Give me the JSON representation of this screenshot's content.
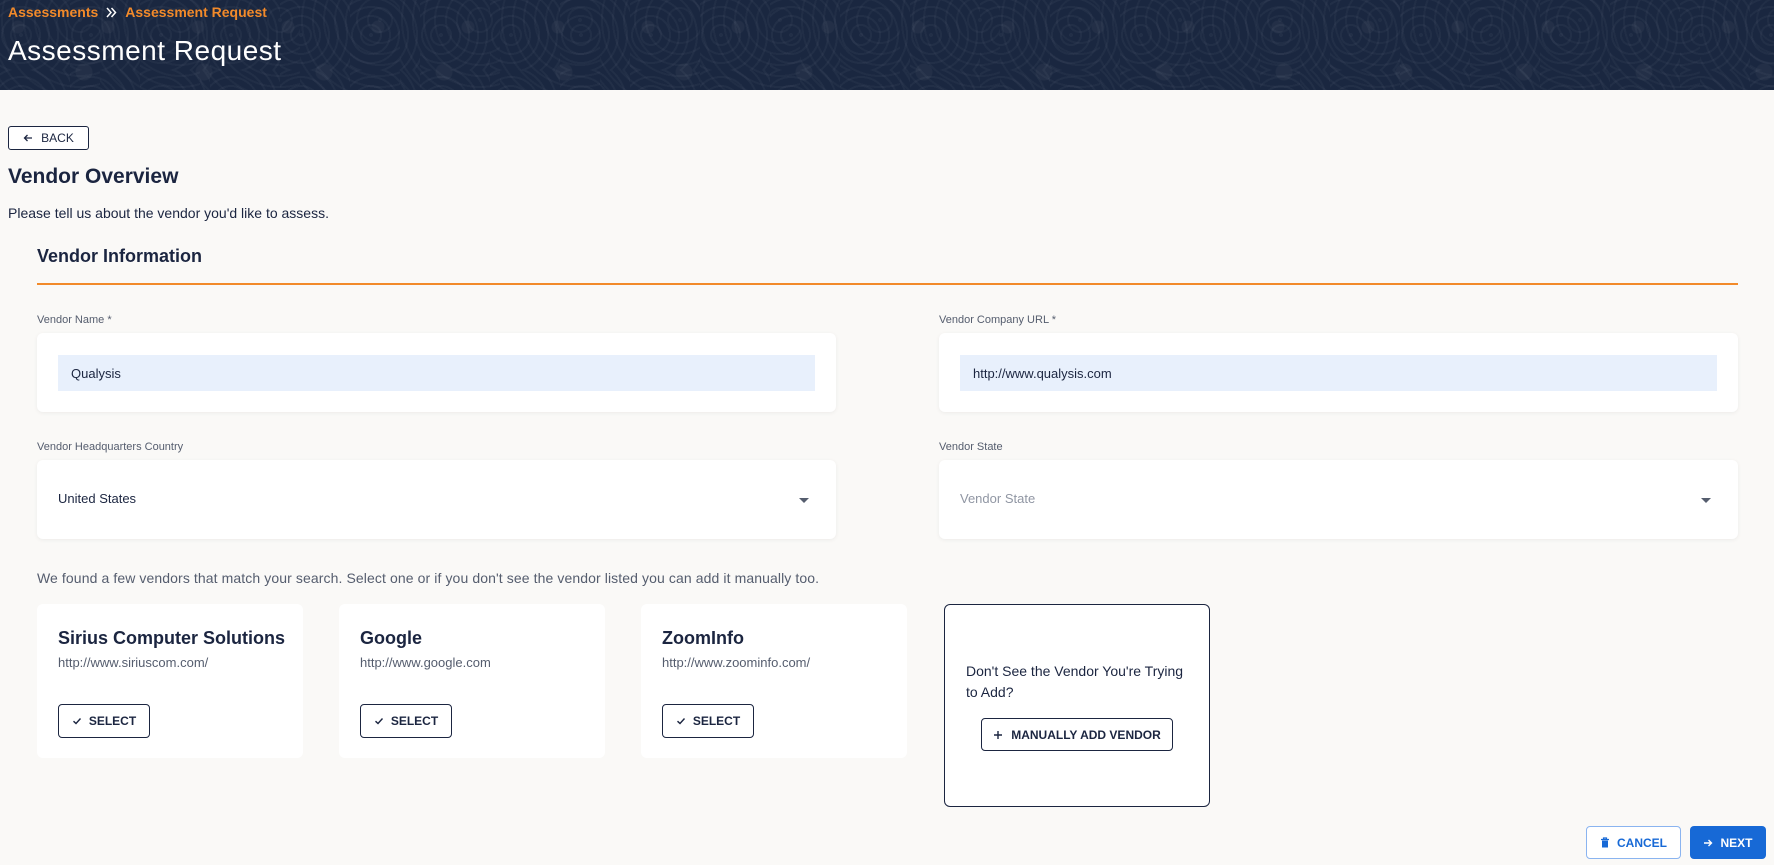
{
  "header": {
    "breadcrumb": [
      "Assessments",
      "Assessment Request"
    ],
    "title": "Assessment Request"
  },
  "back_label": "BACK",
  "overview": {
    "title": "Vendor Overview",
    "description": "Please tell us about the vendor you'd like to assess."
  },
  "vendor_info": {
    "title": "Vendor Information",
    "fields": {
      "name": {
        "label": "Vendor Name *",
        "value": "Qualysis"
      },
      "url": {
        "label": "Vendor Company URL *",
        "value": "http://www.qualysis.com"
      },
      "country": {
        "label": "Vendor Headquarters Country",
        "value": "United States"
      },
      "state": {
        "label": "Vendor State",
        "placeholder": "Vendor State"
      }
    }
  },
  "matches": {
    "intro": "We found a few vendors that match your search. Select one or if you don't see the vendor listed you can add it manually too.",
    "vendors": [
      {
        "name": "Sirius Computer Solutions",
        "url": "http://www.siriuscom.com/",
        "button": "SELECT"
      },
      {
        "name": "Google",
        "url": "http://www.google.com",
        "button": "SELECT"
      },
      {
        "name": "ZoomInfo",
        "url": "http://www.zoominfo.com/",
        "button": "SELECT"
      }
    ],
    "manual": {
      "text": "Don't See the Vendor You're Trying to Add?",
      "button": "MANUALLY ADD VENDOR"
    }
  },
  "footer": {
    "cancel": "CANCEL",
    "next": "NEXT"
  },
  "colors": {
    "accent_orange": "#f28a2a",
    "navy": "#1b2540",
    "primary_blue": "#1769d6"
  },
  "icons": [
    "chevron-double-right-icon",
    "arrow-left-icon",
    "caret-down-icon",
    "check-icon",
    "plus-icon",
    "trash-icon",
    "arrow-right-icon"
  ]
}
